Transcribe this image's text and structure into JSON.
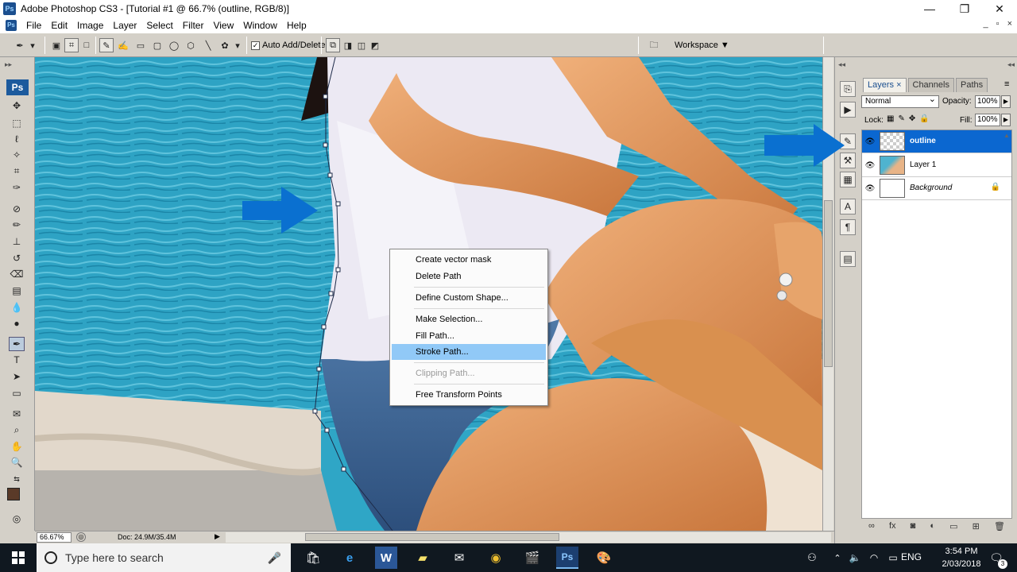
{
  "titlebar": {
    "app_icon": "Ps",
    "title": "Adobe Photoshop CS3 - [Tutorial #1 @ 66.7% (outline, RGB/8)]",
    "minimize": "—",
    "maximize": "❐",
    "close": "✕"
  },
  "menubar": {
    "items": [
      "File",
      "Edit",
      "Image",
      "Layer",
      "Select",
      "Filter",
      "View",
      "Window",
      "Help"
    ],
    "mdi_min": "_",
    "mdi_restore": "▫",
    "mdi_close": "×"
  },
  "optionsbar": {
    "auto_add_delete_label": "Auto Add/Delete",
    "auto_add_delete_checked": true,
    "workspace_label": "Workspace ▼"
  },
  "tools": {
    "logo": "Ps"
  },
  "status": {
    "zoom": "66.67%",
    "doc": "Doc: 24.9M/35.4M"
  },
  "layers_panel": {
    "tabs": [
      {
        "label": "Layers ×"
      },
      {
        "label": "Channels"
      },
      {
        "label": "Paths"
      }
    ],
    "blend_mode": "Normal",
    "opacity_label": "Opacity:",
    "opacity_value": "100%",
    "lock_label": "Lock:",
    "fill_label": "Fill:",
    "fill_value": "100%",
    "layers": [
      {
        "name": "outline",
        "selected": true
      },
      {
        "name": "Layer 1",
        "selected": false
      },
      {
        "name": "Background",
        "selected": false,
        "locked": true
      }
    ]
  },
  "context_menu": {
    "items": [
      {
        "label": "Create vector mask"
      },
      {
        "label": "Delete Path"
      },
      {
        "label": "Define Custom Shape..."
      },
      {
        "label": "Make Selection..."
      },
      {
        "label": "Fill Path..."
      },
      {
        "label": "Stroke Path...",
        "highlighted": true
      },
      {
        "label": "Clipping Path...",
        "disabled": true
      },
      {
        "label": "Free Transform Points"
      }
    ]
  },
  "taskbar": {
    "search_placeholder": "Type here to search",
    "language": "ENG",
    "time": "3:54 PM",
    "date": "2/03/2018",
    "notification_count": "3"
  },
  "colors": {
    "selection_blue": "#0b67d0",
    "menu_highlight": "#91c9f7",
    "annotation_arrow": "#0a70d0",
    "water": "#2fa6c6"
  }
}
